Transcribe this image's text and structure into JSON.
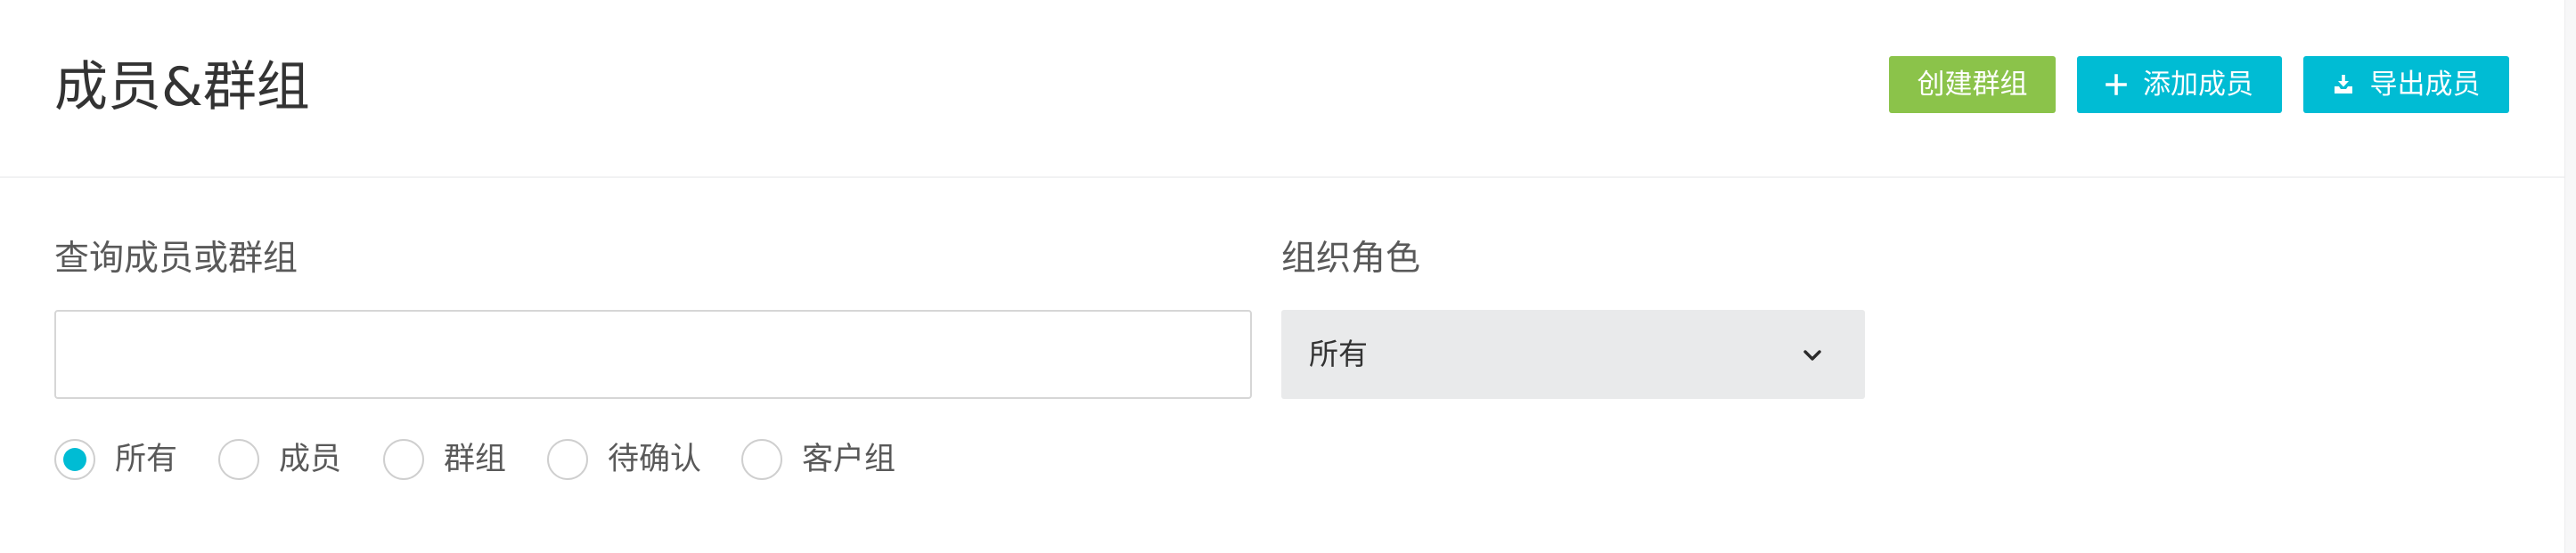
{
  "header": {
    "title": "成员&群组",
    "buttons": {
      "create_group": "创建群组",
      "add_member": "添加成员",
      "export_members": "导出成员"
    }
  },
  "filters": {
    "search": {
      "label": "查询成员或群组",
      "value": ""
    },
    "role": {
      "label": "组织角色",
      "selected": "所有"
    },
    "type": {
      "options": [
        "所有",
        "成员",
        "群组",
        "待确认",
        "客户组"
      ],
      "selected": "所有"
    }
  },
  "icons": {
    "add_member": "plus-icon",
    "export_members": "download-icon",
    "role_dropdown": "chevron-down-icon"
  },
  "colors": {
    "primary": "#00bcd4",
    "success": "#8bc34a",
    "title": "#333333",
    "label": "#595959"
  }
}
